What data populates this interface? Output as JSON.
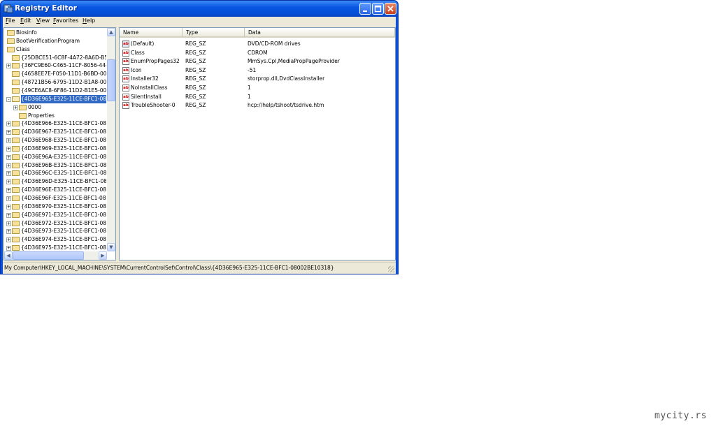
{
  "window": {
    "title": "Registry Editor",
    "icon": "registry-editor-icon",
    "controls": [
      "minimize-icon",
      "maximize-icon",
      "close-icon"
    ]
  },
  "menu": [
    {
      "label": "File",
      "mnemonic": "F",
      "rest": "ile"
    },
    {
      "label": "Edit",
      "mnemonic": "E",
      "rest": "dit"
    },
    {
      "label": "View",
      "mnemonic": "V",
      "rest": "iew"
    },
    {
      "label": "Favorites",
      "mnemonic": "F",
      "rest": "avorites"
    },
    {
      "label": "Help",
      "mnemonic": "H",
      "rest": "elp"
    }
  ],
  "tree": [
    {
      "label": "Biosinfo",
      "expander": ""
    },
    {
      "label": "BootVerificationProgram",
      "expander": ""
    },
    {
      "label": "Class",
      "expander": ""
    },
    {
      "label": "{25DBCE51-6C8F-4A72-8A6D-B54",
      "expander": ""
    },
    {
      "label": "{36FC9E60-C465-11CF-8056-444",
      "expander": "+"
    },
    {
      "label": "{4658EE7E-F050-11D1-B6BD-00C",
      "expander": ""
    },
    {
      "label": "{48721B56-6795-11D2-B1A8-008",
      "expander": ""
    },
    {
      "label": "{49CE6AC8-6F86-11D2-B1E5-008",
      "expander": ""
    },
    {
      "label": "{4D36E965-E325-11CE-BFC1-080",
      "expander": "-",
      "selected": true
    },
    {
      "label": "0000",
      "expander": "+"
    },
    {
      "label": "Properties",
      "expander": ""
    },
    {
      "label": "{4D36E966-E325-11CE-BFC1-080",
      "expander": "+"
    },
    {
      "label": "{4D36E967-E325-11CE-BFC1-080",
      "expander": "+"
    },
    {
      "label": "{4D36E968-E325-11CE-BFC1-080",
      "expander": "+"
    },
    {
      "label": "{4D36E969-E325-11CE-BFC1-080",
      "expander": "+"
    },
    {
      "label": "{4D36E96A-E325-11CE-BFC1-080",
      "expander": "+"
    },
    {
      "label": "{4D36E96B-E325-11CE-BFC1-080",
      "expander": "+"
    },
    {
      "label": "{4D36E96C-E325-11CE-BFC1-080",
      "expander": "+"
    },
    {
      "label": "{4D36E96D-E325-11CE-BFC1-080",
      "expander": "+"
    },
    {
      "label": "{4D36E96E-E325-11CE-BFC1-080",
      "expander": "+"
    },
    {
      "label": "{4D36E96F-E325-11CE-BFC1-080",
      "expander": "+"
    },
    {
      "label": "{4D36E970-E325-11CE-BFC1-080",
      "expander": "+"
    },
    {
      "label": "{4D36E971-E325-11CE-BFC1-080",
      "expander": "+"
    },
    {
      "label": "{4D36E972-E325-11CE-BFC1-080",
      "expander": "+"
    },
    {
      "label": "{4D36E973-E325-11CE-BFC1-080",
      "expander": "+"
    },
    {
      "label": "{4D36E974-E325-11CE-BFC1-080",
      "expander": "+"
    },
    {
      "label": "{4D36E975-E325-11CE-BFC1-080",
      "expander": "+"
    }
  ],
  "columns": {
    "name": "Name",
    "type": "Type",
    "data": "Data"
  },
  "values": [
    {
      "name": "(Default)",
      "type": "REG_SZ",
      "data": "DVD/CD-ROM drives",
      "icon": "ab"
    },
    {
      "name": "Class",
      "type": "REG_SZ",
      "data": "CDROM",
      "icon": "ab"
    },
    {
      "name": "EnumPropPages32",
      "type": "REG_SZ",
      "data": "MmSys.Cpl,MediaPropPageProvider",
      "icon": "ab"
    },
    {
      "name": "Icon",
      "type": "REG_SZ",
      "data": "-51",
      "icon": "ab"
    },
    {
      "name": "Installer32",
      "type": "REG_SZ",
      "data": "storprop.dll,DvdClassInstaller",
      "icon": "ab"
    },
    {
      "name": "NoInstallClass",
      "type": "REG_SZ",
      "data": "1",
      "icon": "ab"
    },
    {
      "name": "SilentInstall",
      "type": "REG_SZ",
      "data": "1",
      "icon": "ab"
    },
    {
      "name": "TroubleShooter-0",
      "type": "REG_SZ",
      "data": "hcp://help/tshoot/tsdrive.htm",
      "icon": "ab"
    }
  ],
  "status": "My Computer\\HKEY_LOCAL_MACHINE\\SYSTEM\\CurrentControlSet\\Control\\Class\\{4D36E965-E325-11CE-BFC1-08002BE10318}",
  "watermark": "mycity.rs",
  "colors": {
    "titlebar": "#0757e3",
    "selection": "#316ac5",
    "chrome": "#ece9d8"
  }
}
